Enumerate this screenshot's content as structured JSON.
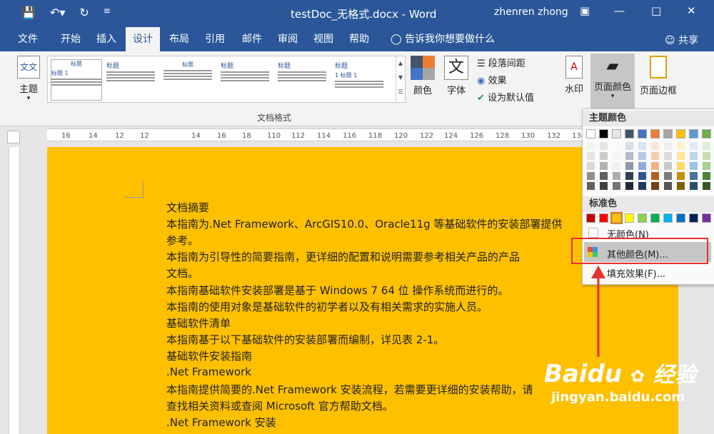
{
  "title_bar": {
    "title": "testDoc_无格式.docx - Word",
    "user": "zhenren zhong"
  },
  "tabs": [
    {
      "label": "文件"
    },
    {
      "label": "开始"
    },
    {
      "label": "插入"
    },
    {
      "label": "设计"
    },
    {
      "label": "布局"
    },
    {
      "label": "引用"
    },
    {
      "label": "邮件"
    },
    {
      "label": "审阅"
    },
    {
      "label": "视图"
    },
    {
      "label": "帮助"
    }
  ],
  "tell_me": "告诉我你想要做什么",
  "share": "共享",
  "ribbon": {
    "theme_label": "主题",
    "gallery_thumbs": [
      {
        "head": "标题",
        "sub": "标题 1"
      },
      {
        "head": "标题",
        "sub": ""
      },
      {
        "head": "标题",
        "sub": ""
      },
      {
        "head": "标题",
        "sub": ""
      },
      {
        "head": "标题",
        "sub": ""
      },
      {
        "head": "标题",
        "sub": "1 标题 1"
      }
    ],
    "colors_label": "颜色",
    "fonts_label": "字体",
    "paragraph_spacing_label": "段落间距",
    "effects_label": "效果",
    "set_default_label": "设为默认值",
    "watermark_label": "水印",
    "page_color_label": "页面颜色",
    "page_border_label": "页面边框",
    "group_label": "文档格式"
  },
  "ruler_numbers": [
    "16",
    "14",
    "12",
    "12",
    "14",
    "16",
    "18",
    "110",
    "112",
    "114",
    "116",
    "118",
    "120",
    "122",
    "124",
    "126",
    "128",
    "130",
    "132",
    "134"
  ],
  "document": {
    "lines": [
      "文档摘要",
      "本指南为.Net Framework、ArcGIS10.0、Oracle11g 等基础软件的安装部署提供",
      "参考。",
      "本指南为引导性的简要指南，更详细的配置和说明需要参考相关产品的产品",
      "文档。",
      "本指南基础软件安装部署是基于  Windows 7 64 位  操作系统而进行的。",
      "本指南的使用对象是基础软件的初学者以及有相关需求的实施人员。",
      "基础软件清单",
      "本指南基于以下基础软件的安装部署而编制，详见表 2-1。",
      "基础软件安装指南",
      ".Net Framework",
      "本指南提供简要的.Net Framework 安装流程，若需要更详细的安装帮助，请",
      "查找相关资料或查阅 Microsoft 官方帮助文档。",
      ".Net Framework 安装"
    ]
  },
  "page_color_menu": {
    "theme_colors_label": "主题颜色",
    "standard_colors_label": "标准色",
    "no_color_label": "无颜色(N)",
    "more_colors_label": "其他颜色(M)...",
    "fill_effects_label": "填充效果(F)...",
    "theme_top_row": [
      "#ffffff",
      "#000000",
      "#e7e6e6",
      "#44546a",
      "#4472c4",
      "#ed7d31",
      "#a5a5a5",
      "#ffc000",
      "#5b9bd5",
      "#70ad47"
    ],
    "standard_row": [
      "#c00000",
      "#ff0000",
      "#ffc000",
      "#ffff00",
      "#92d050",
      "#00b050",
      "#00b0f0",
      "#0070c0",
      "#002060",
      "#7030a0"
    ]
  },
  "watermark": {
    "brand": "Baidu",
    "brand_cn": "经验",
    "url": "jingyan.baidu.com"
  }
}
